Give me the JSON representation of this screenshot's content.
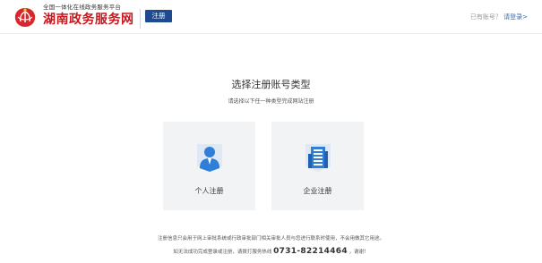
{
  "header": {
    "brand_subtitle": "全国一体化在线政务服务平台",
    "brand_title": "湖南政务服务网",
    "register_badge": "注册",
    "login_prompt": "已有账号？",
    "login_link": "请登录>"
  },
  "main": {
    "title": "选择注册账号类型",
    "subtitle": "请选择以下任一种类型完成网站注册",
    "cards": [
      {
        "label": "个人注册",
        "icon": "person-icon"
      },
      {
        "label": "企业注册",
        "icon": "building-icon"
      }
    ]
  },
  "footer": {
    "notice": "注册信息只会用于网上审批系统或行政审批部门相关审批人员与您进行联系时使用，不会用做其它用途。",
    "help_prefix": "如无法成功完成登录或注册，请拨打服务热线",
    "hotline": "0731-82214464",
    "help_suffix": "，谢谢！"
  },
  "colors": {
    "brand_red": "#c8161d",
    "badge_blue": "#1e4b8f",
    "link_blue": "#2d6cc0",
    "icon_blue": "#2f7fd8",
    "card_bg": "#f2f3f5"
  }
}
